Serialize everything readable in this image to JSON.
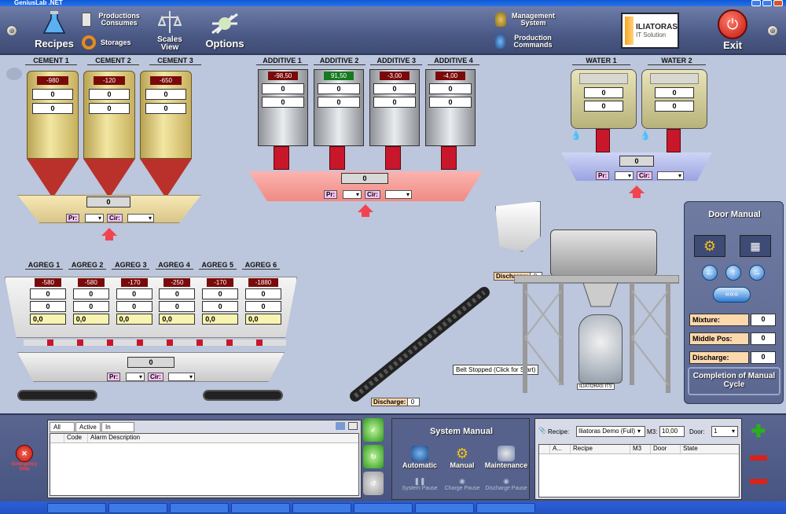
{
  "window": {
    "title": "GeniusLab .NET"
  },
  "nav": {
    "recipes": "Recipes",
    "productions_consumes": "Productions Consumes",
    "storages": "Storages",
    "scales_view": "Scales View",
    "options": "Options",
    "management_system": "Management System",
    "production_commands": "Production Commands",
    "logo_name": "ILIATORAS",
    "logo_sub": "IT Solution",
    "exit": "Exit"
  },
  "cement": {
    "labels": [
      "CEMENT 1",
      "CEMENT 2",
      "CEMENT 3"
    ],
    "values": [
      "-980",
      "-120",
      "-650"
    ],
    "scale": "0",
    "pr": "Pr:",
    "cir": "Cir:"
  },
  "additive": {
    "labels": [
      "ADDITIVE 1",
      "ADDITIVE 2",
      "ADDITIVE 3",
      "ADDITIVE 4"
    ],
    "values": [
      "-98,50",
      "91,50",
      "-3,00",
      "-4,00"
    ],
    "scale": "0",
    "pr": "Pr:",
    "cir": "Cir:"
  },
  "water": {
    "labels": [
      "WATER 1",
      "WATER 2"
    ],
    "scale": "0",
    "pr": "Pr:",
    "cir": "Cir:"
  },
  "agreg": {
    "labels": [
      "AGREG 1",
      "AGREG 2",
      "AGREG 3",
      "AGREG 4",
      "AGREG 5",
      "AGREG 6"
    ],
    "values": [
      "-580",
      "-580",
      "-170",
      "-250",
      "-170",
      "-1880"
    ],
    "spin": "0,0",
    "scale": "0",
    "pr": "Pr:",
    "cir": "Cir:"
  },
  "zero": "0",
  "discharge_label": "Discharge:",
  "belt_status": "Belt Stopped (Click for Start)",
  "truck_label": "ILIATORAS ITS",
  "door_panel": {
    "title": "Door Manual",
    "mixture": "Mixture:",
    "middle_pos": "Middle Pos:",
    "discharge": "Discharge:",
    "completion": "Completion of Manual Cycle"
  },
  "alarm": {
    "tabs": [
      "All",
      "Active",
      "In Silence"
    ],
    "col_code": "Code",
    "col_desc": "Alarm Description",
    "emergency": "Emergency Stop"
  },
  "system": {
    "title": "System Manual",
    "automatic": "Automatic",
    "manual": "Manual",
    "maintenance": "Maintenance",
    "system_pause": "System Pause",
    "charge_pause": "Charge Pause",
    "discharge_pause": "Discharge Pause"
  },
  "recipe": {
    "label": "Recipe:",
    "value": "Iliatoras Demo (Full)",
    "m3_label": "M3:",
    "m3_value": "10,00",
    "door_label": "Door:",
    "door_value": "1",
    "cols": [
      "A...",
      "Recipe",
      "M3",
      "Door",
      "State"
    ]
  },
  "colors": {
    "accent": "#4b5a86",
    "alarm_red": "#7a0a0a",
    "pipe_red": "#c8172a"
  }
}
